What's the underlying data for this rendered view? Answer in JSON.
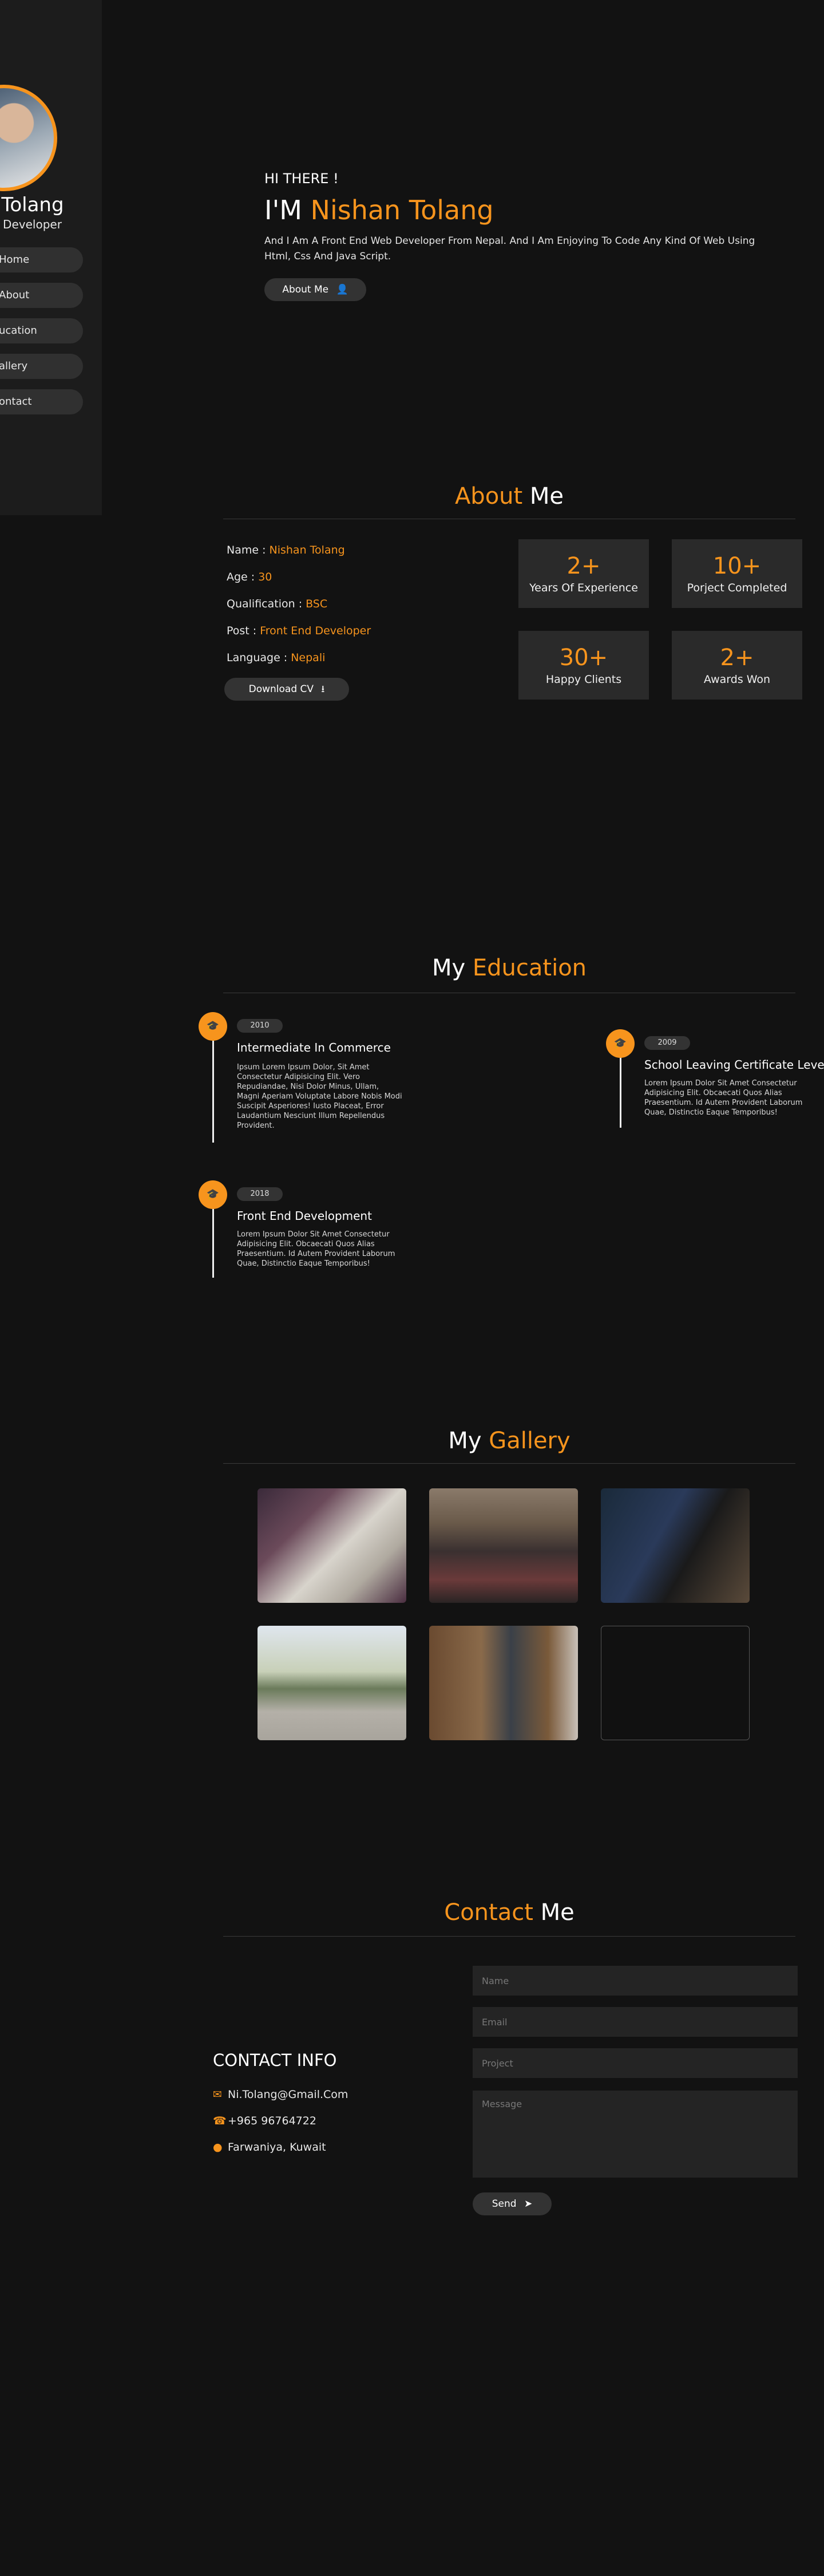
{
  "sidebar": {
    "name": "n Tolang",
    "role": "d Developer",
    "nav": [
      "Home",
      "About",
      "ucation",
      "allery",
      "ontact"
    ]
  },
  "hero": {
    "greeting": "HI THERE !",
    "title_prefix": "I'M ",
    "title_name": "Nishan Tolang",
    "description": "And I Am A Front End Web Developer From Nepal. And I Am Enjoying To Code Any Kind Of Web Using Html, Css And Java Script.",
    "button_label": "About Me"
  },
  "about": {
    "title_a": "About",
    "title_b": " Me",
    "info": [
      {
        "label": "Name :",
        "value": "Nishan Tolang"
      },
      {
        "label": "Age :",
        "value": "30"
      },
      {
        "label": "Qualification :",
        "value": "BSC"
      },
      {
        "label": "Post :",
        "value": "Front End Developer"
      },
      {
        "label": "Language :",
        "value": "Nepali"
      }
    ],
    "cv_label": "Download CV",
    "stats": [
      {
        "num": "2+",
        "label": "Years Of Experience"
      },
      {
        "num": "10+",
        "label": "Porject Completed"
      },
      {
        "num": "30+",
        "label": "Happy Clients"
      },
      {
        "num": "2+",
        "label": "Awards Won"
      }
    ]
  },
  "education": {
    "title_a": "My",
    "title_b": " Education",
    "items": [
      {
        "year": "2010",
        "heading": "Intermediate In Commerce",
        "body": "Ipsum Lorem Ipsum Dolor, Sit Amet Consectetur Adipisicing Elit. Vero Repudiandae, Nisi Dolor Minus, Ullam, Magni Aperiam Voluptate Labore Nobis Modi Suscipit Asperiores! Iusto Placeat, Error Laudantium Nesciunt Illum Repellendus Provident."
      },
      {
        "year": "2009",
        "heading": "School Leaving Certificate Level",
        "body": "Lorem Ipsum Dolor Sit Amet Consectetur Adipisicing Elit. Obcaecati Quos Alias Praesentium. Id Autem Provident Laborum Quae, Distinctio Eaque Temporibus!"
      },
      {
        "year": "2018",
        "heading": "Front End Development",
        "body": "Lorem Ipsum Dolor Sit Amet Consectetur Adipisicing Elit. Obcaecati Quos Alias Praesentium. Id Autem Provident Laborum Quae, Distinctio Eaque Temporibus!"
      }
    ]
  },
  "gallery": {
    "title_a": "My",
    "title_b": " Gallery"
  },
  "contact": {
    "title_a": "Contact",
    "title_b": " Me",
    "info_title": "CONTACT INFO",
    "email": "Ni.Tolang@Gmail.Com",
    "phone": "+965 96764722",
    "address": "Farwaniya, Kuwait",
    "placeholders": {
      "name": "Name",
      "email": "Email",
      "project": "Project",
      "message": "Message"
    },
    "send_label": "Send"
  },
  "colors": {
    "accent": "#f7941d",
    "background": "#121212",
    "sidebar": "#1c1c1c"
  }
}
